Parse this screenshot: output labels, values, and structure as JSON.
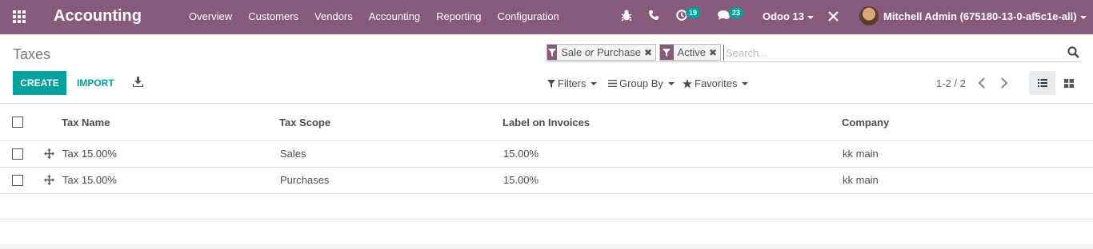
{
  "navbar": {
    "brand": "Accounting",
    "menu": [
      "Overview",
      "Customers",
      "Vendors",
      "Accounting",
      "Reporting",
      "Configuration"
    ],
    "activity_count": "19",
    "messages_count": "23",
    "db_name": "Odoo 13",
    "user_name": "Mitchell Admin (675180-13-0-af5c1e-all)",
    "color": "#875a7b"
  },
  "control_panel": {
    "breadcrumb": "Taxes",
    "facets": [
      {
        "parts": [
          "Sale",
          " or ",
          "Purchase"
        ]
      },
      {
        "label": "Active"
      }
    ],
    "search_placeholder": "Search...",
    "create_label": "CREATE",
    "import_label": "IMPORT",
    "filters_label": "Filters",
    "groupby_label": "Group By",
    "favorites_label": "Favorites",
    "pager": "1-2 / 2",
    "accent": "#00a09d"
  },
  "table": {
    "columns": [
      "Tax Name",
      "Tax Scope",
      "Label on Invoices",
      "Company"
    ],
    "rows": [
      {
        "name": "Tax 15.00%",
        "scope": "Sales",
        "label": "15.00%",
        "company": "kk main"
      },
      {
        "name": "Tax 15.00%",
        "scope": "Purchases",
        "label": "15.00%",
        "company": "kk main"
      }
    ]
  }
}
